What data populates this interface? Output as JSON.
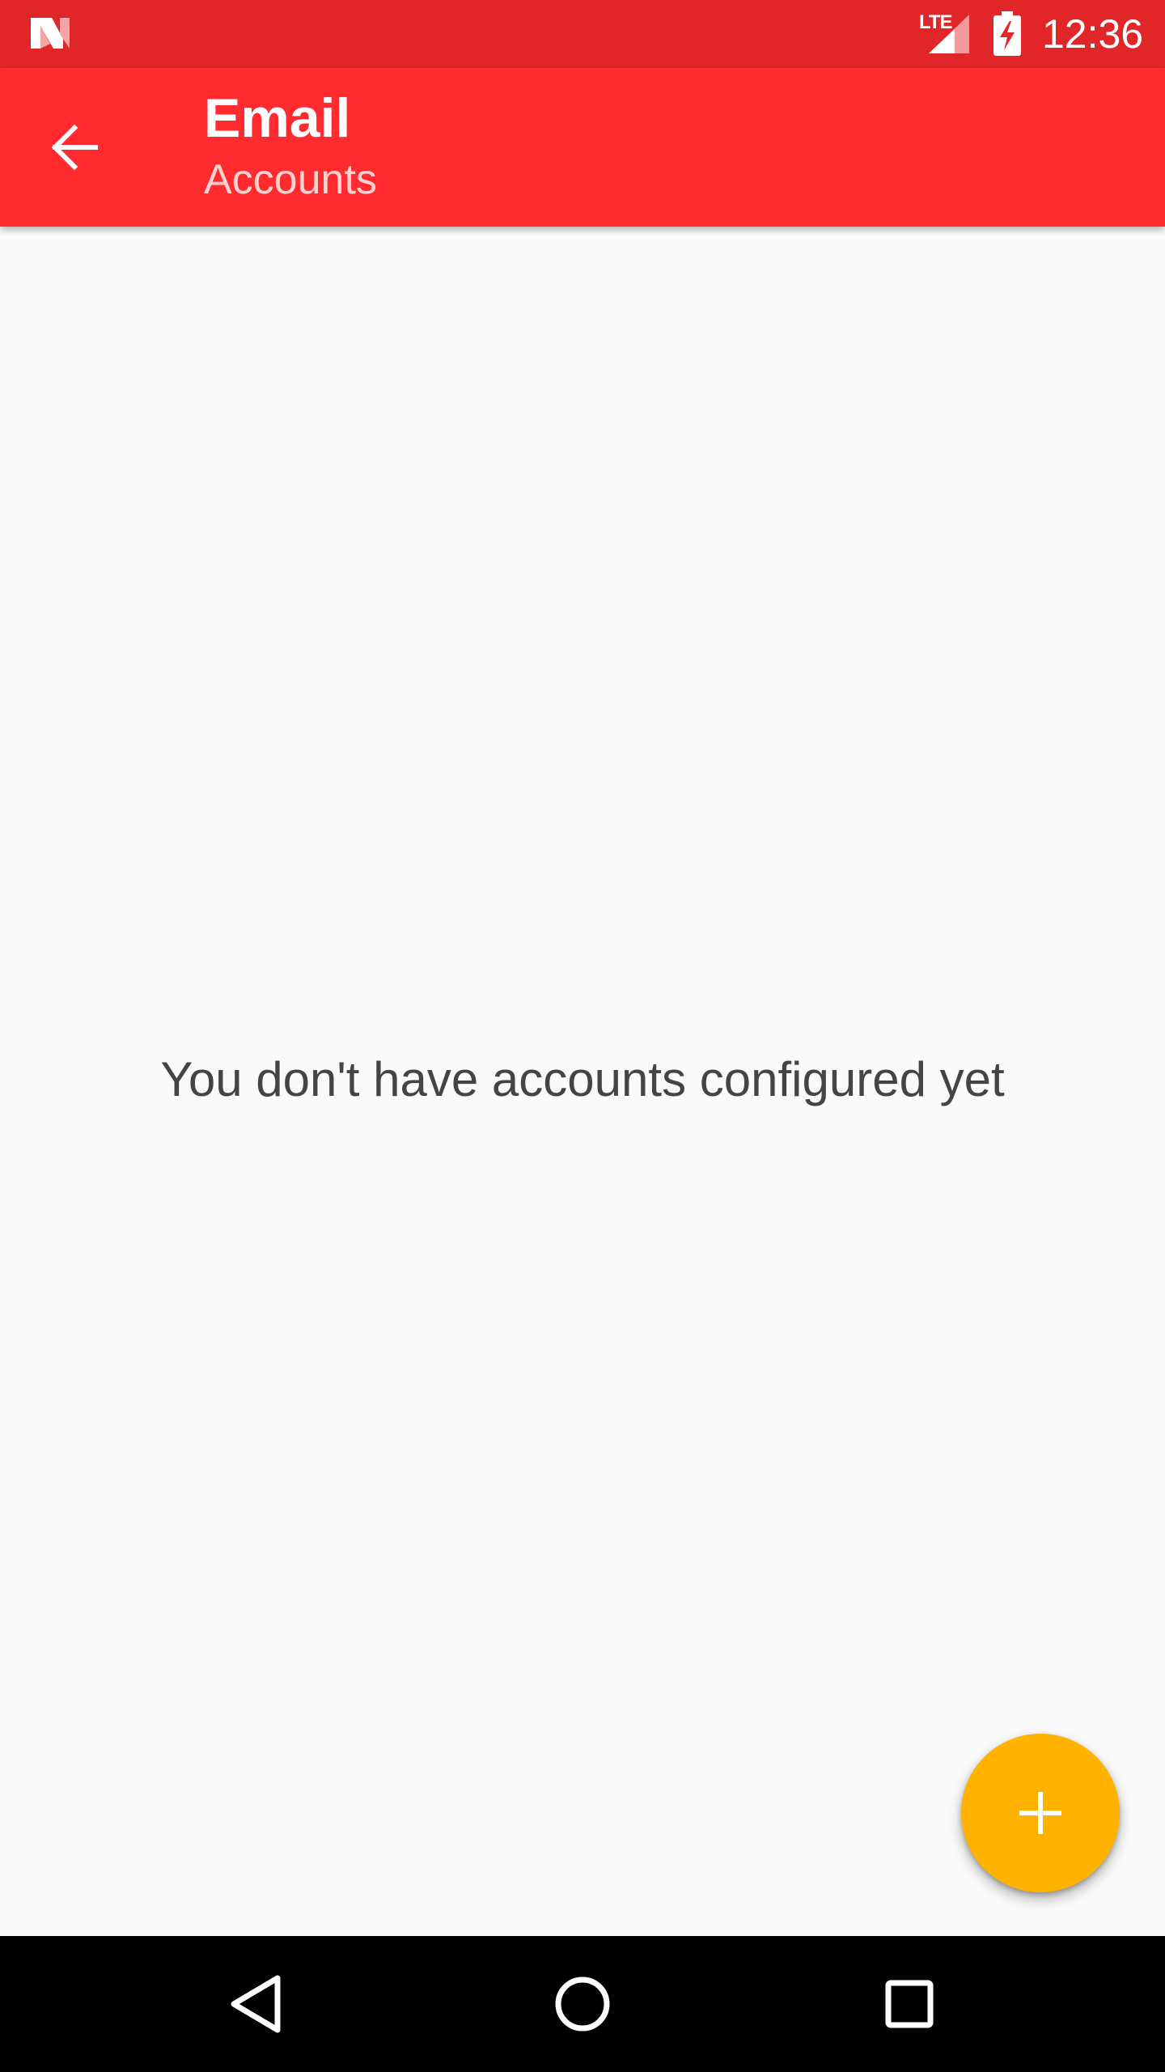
{
  "status_bar": {
    "network_label": "LTE",
    "time": "12:36",
    "background_color": "#e02628",
    "icons": [
      "n-logo-icon",
      "signal-icon",
      "battery-charging-icon"
    ]
  },
  "toolbar": {
    "title": "Email",
    "subtitle": "Accounts",
    "background_color": "#ff2b2f",
    "back_icon": "arrow-back-icon"
  },
  "main": {
    "empty_message": "You don't have accounts configured yet",
    "background_color": "#fafafa"
  },
  "fab": {
    "icon": "plus-icon",
    "color": "#ffb300"
  },
  "nav_bar": {
    "icons": [
      "nav-back-icon",
      "nav-home-icon",
      "nav-recents-icon"
    ]
  }
}
